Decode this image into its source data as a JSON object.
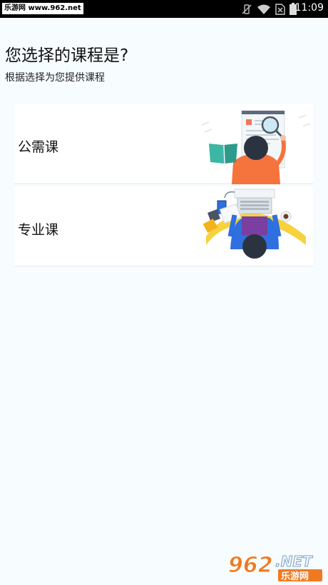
{
  "status_bar": {
    "watermark": "乐游网 www.962.net",
    "time": "11:09"
  },
  "page": {
    "title": "您选择的课程是?",
    "subtitle": "根据选择为您提供课程"
  },
  "courses": [
    {
      "label": "公需课",
      "illustration": "researcher-with-magnifier-illustration"
    },
    {
      "label": "专业课",
      "illustration": "student-at-laptop-illustration"
    }
  ],
  "brand": {
    "number": "962",
    "suffix": ".NET",
    "name": "乐游网"
  },
  "colors": {
    "background": "#f7fcff",
    "accent_orange": "#f5733d",
    "accent_teal": "#3cb6a5",
    "accent_blue": "#2f6fe0",
    "logo_orange": "#f07a22"
  }
}
